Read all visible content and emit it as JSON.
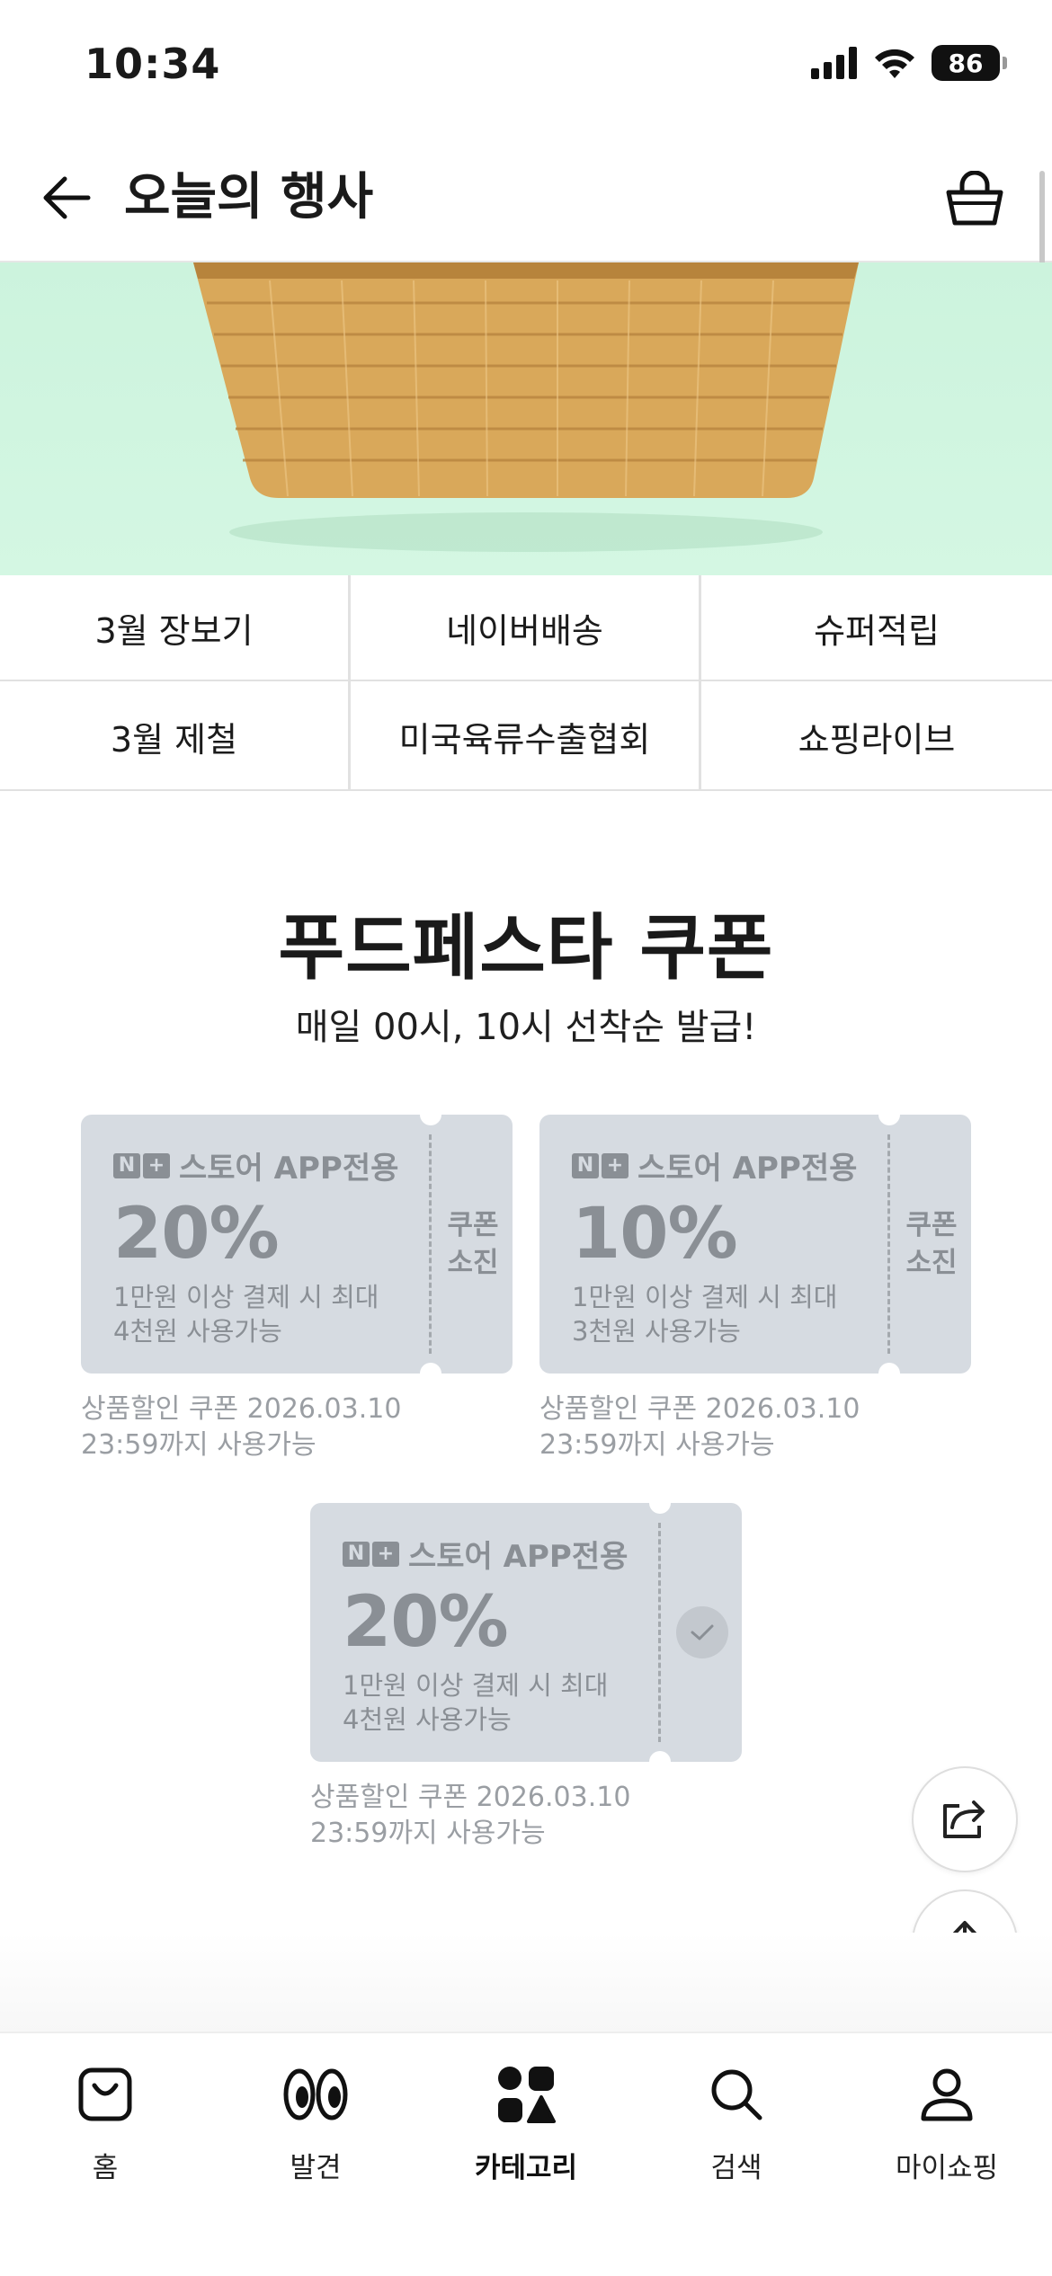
{
  "status_bar": {
    "time": "10:34",
    "battery": "86"
  },
  "header": {
    "title": "오늘의 행사"
  },
  "categories": [
    {
      "label": "3월 장보기"
    },
    {
      "label": "네이버배송"
    },
    {
      "label": "슈퍼적립"
    },
    {
      "label": "3월 제철"
    },
    {
      "label": "미국육류수출협회"
    },
    {
      "label": "쇼핑라이브"
    }
  ],
  "section": {
    "title": "푸드페스타 쿠폰",
    "subtitle": "매일 00시, 10시 선착순 발급!"
  },
  "coupons": [
    {
      "store_label": "스토어 APP전용",
      "discount": "20%",
      "cond_line1": "1만원 이상 결제 시 최대",
      "cond_line2": "4천원 사용가능",
      "status_line1": "쿠폰",
      "status_line2": "소진",
      "note_line1": "상품할인 쿠폰 2026.03.10",
      "note_line2": "23:59까지 사용가능"
    },
    {
      "store_label": "스토어 APP전용",
      "discount": "10%",
      "cond_line1": "1만원 이상 결제 시 최대",
      "cond_line2": "3천원 사용가능",
      "status_line1": "쿠폰",
      "status_line2": "소진",
      "note_line1": "상품할인 쿠폰 2026.03.10",
      "note_line2": "23:59까지 사용가능"
    },
    {
      "store_label": "스토어 APP전용",
      "discount": "20%",
      "cond_line1": "1만원 이상 결제 시 최대",
      "cond_line2": "4천원 사용가능",
      "status_icon": "check-icon",
      "note_line1": "상품할인 쿠폰 2026.03.10",
      "note_line2": "23:59까지 사용가능"
    }
  ],
  "bottom_nav": [
    {
      "label": "홈",
      "icon": "shopping-bag-icon"
    },
    {
      "label": "발견",
      "icon": "eyes-icon"
    },
    {
      "label": "카테고리",
      "icon": "category-shapes-icon",
      "active": true
    },
    {
      "label": "검색",
      "icon": "search-icon"
    },
    {
      "label": "마이쇼핑",
      "icon": "person-icon"
    }
  ],
  "colors": {
    "coupon_bg": "#d6dbe1",
    "coupon_text": "#8a8f95",
    "banner_bg": "#ccf3dd",
    "basket": "#d9a85a"
  }
}
